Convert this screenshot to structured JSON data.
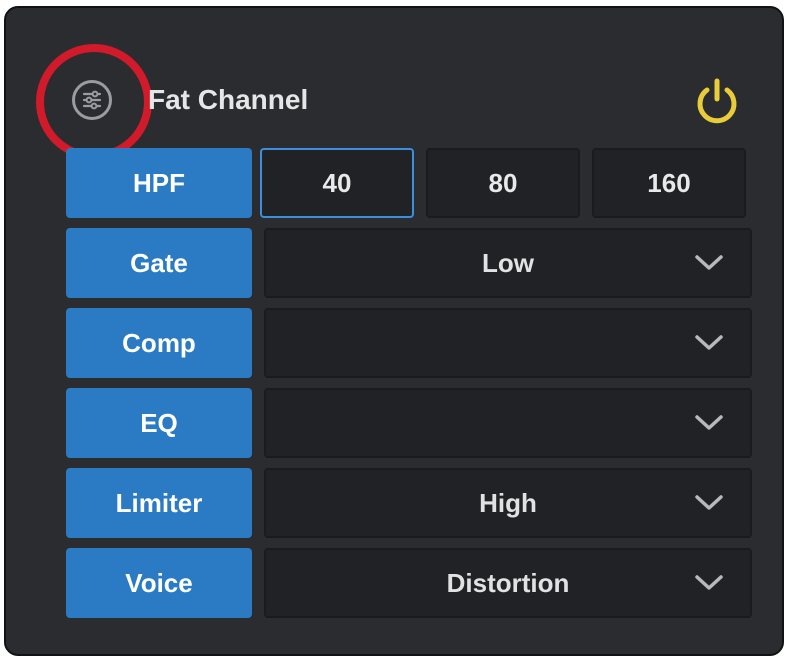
{
  "header": {
    "title": "Fat Channel",
    "settings_icon": "sliders-icon",
    "power_icon": "power-icon",
    "power_color": "#e9cc3a",
    "highlight_color": "#d11a2a"
  },
  "accent_color": "#2a7bc4",
  "hpf": {
    "label": "HPF",
    "options": [
      "40",
      "80",
      "160"
    ],
    "selected": "40"
  },
  "rows": [
    {
      "label": "Gate",
      "value": "Low"
    },
    {
      "label": "Comp",
      "value": ""
    },
    {
      "label": "EQ",
      "value": ""
    },
    {
      "label": "Limiter",
      "value": "High"
    },
    {
      "label": "Voice",
      "value": "Distortion"
    }
  ]
}
